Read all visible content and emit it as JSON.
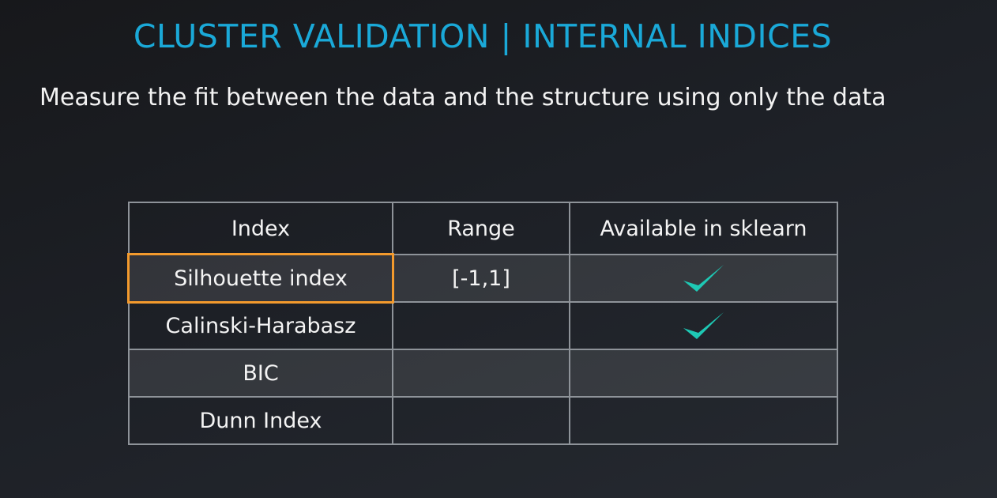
{
  "slide": {
    "title": "CLUSTER VALIDATION | INTERNAL INDICES",
    "subtitle": "Measure the fit between the data and the structure using only the data"
  },
  "table": {
    "headers": [
      "Index",
      "Range",
      "Available in sklearn"
    ],
    "rows": [
      {
        "index": "Silhouette index",
        "range": "[-1,1]",
        "sklearn": "check-icon",
        "highlighted": true
      },
      {
        "index": "Calinski-Harabasz",
        "range": "",
        "sklearn": "check-icon",
        "highlighted": false
      },
      {
        "index": "BIC",
        "range": "",
        "sklearn": "",
        "highlighted": false
      },
      {
        "index": "Dunn Index",
        "range": "",
        "sklearn": "",
        "highlighted": false
      }
    ]
  },
  "colors": {
    "title": "#1aa9d8",
    "highlight": "#f39a2d",
    "check": "#1ec8b4"
  }
}
